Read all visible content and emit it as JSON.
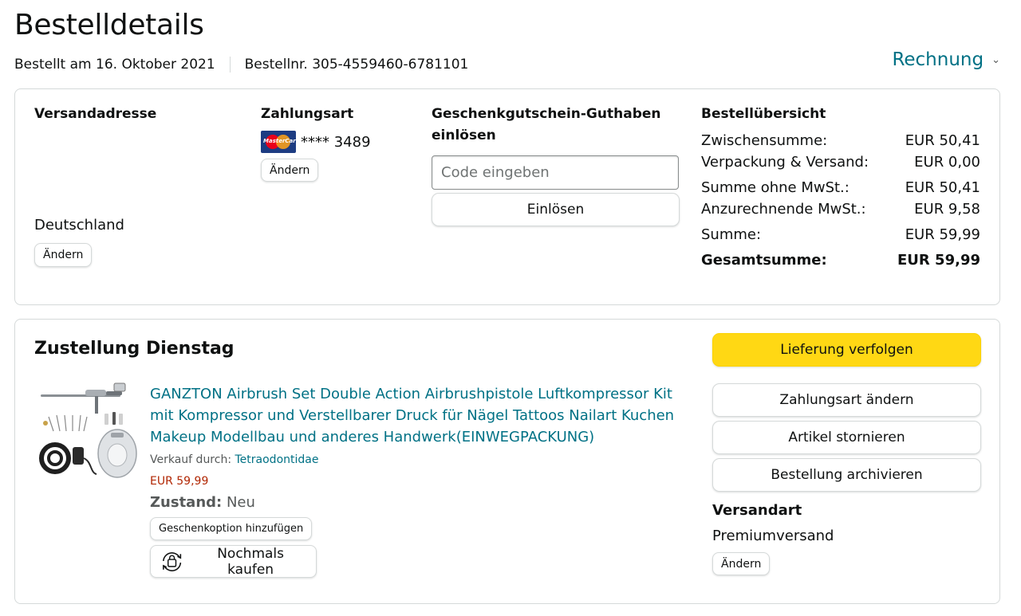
{
  "page": {
    "title": "Bestelldetails",
    "order_date": "Bestellt am 16. Oktober 2021",
    "order_number": "Bestellnr. 305-4559460-6781101",
    "invoice_link": "Rechnung"
  },
  "summary_card": {
    "shipping_address": {
      "heading": "Versandadresse",
      "country": "Deutschland",
      "change_label": "Ändern"
    },
    "payment": {
      "heading": "Zahlungsart",
      "card_number": "**** 3489",
      "card_brand_text": "MasterCard",
      "change_label": "Ändern"
    },
    "gift_card": {
      "heading": "Geschenkgutschein-Guthaben einlösen",
      "input_placeholder": "Code eingeben",
      "redeem_label": "Einlösen"
    },
    "order_summary": {
      "heading": "Bestellübersicht",
      "rows": [
        {
          "label": "Zwischensumme:",
          "value": "EUR 50,41"
        },
        {
          "label": "Verpackung & Versand:",
          "value": "EUR 0,00"
        },
        {
          "label": "Summe ohne MwSt.:",
          "value": "EUR 50,41"
        },
        {
          "label": "Anzurechnende MwSt.:",
          "value": "EUR 9,58"
        },
        {
          "label": "Summe:",
          "value": "EUR 59,99"
        }
      ],
      "total": {
        "label": "Gesamtsumme:",
        "value": "EUR 59,99"
      }
    }
  },
  "delivery_card": {
    "heading": "Zustellung Dienstag",
    "product": {
      "title": "GANZTON Airbrush Set Double Action Airbrushpistole Luftkompressor Kit mit Kompressor und Verstellbarer Druck für Nägel Tattoos Nailart Kuchen Makeup Modellbau und anderes Handwerk(EINWEGPACKUNG)",
      "sold_by_label": "Verkauf durch:",
      "seller": "Tetraodontidae",
      "price": "EUR 59,99",
      "condition_label": "Zustand:",
      "condition_value": "Neu",
      "gift_option_label": "Geschenkoption hinzufügen",
      "buy_again_label": "Nochmals kaufen"
    },
    "actions": {
      "track": "Lieferung verfolgen",
      "change_payment": "Zahlungsart ändern",
      "cancel_item": "Artikel stornieren",
      "archive_order": "Bestellung archivieren"
    },
    "shipping_method": {
      "heading": "Versandart",
      "value": "Premiumversand",
      "change_label": "Ändern"
    }
  },
  "colors": {
    "link": "#007185",
    "price": "#b12704",
    "primary_button": "#ffd814",
    "border": "#d5d9d9"
  }
}
